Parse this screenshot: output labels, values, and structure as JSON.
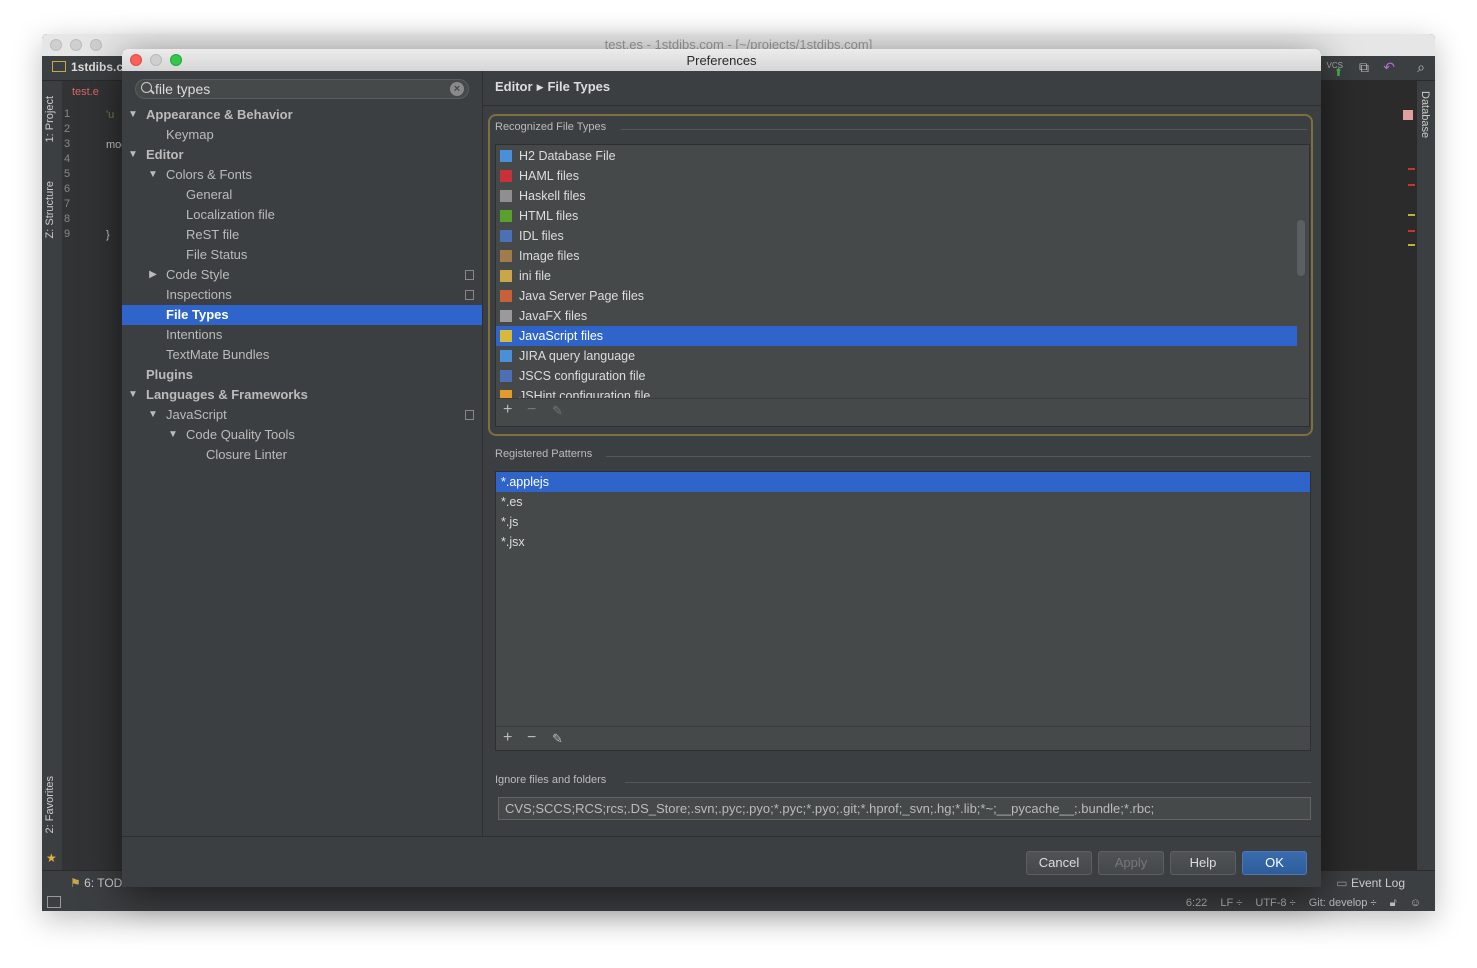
{
  "ide": {
    "window_title": "test.es - 1stdibs.com - [~/projects/1stdibs.com]",
    "project_label": "1stdibs.c",
    "editor_tab": "test.e",
    "left_tabs": [
      "1: Project",
      "Z: Structure",
      "2: Favorites"
    ],
    "right_tab": "Database",
    "vcs_label": "VCS",
    "line_numbers": [
      "1",
      "2",
      "3",
      "4",
      "5",
      "6",
      "7",
      "8",
      "9"
    ],
    "code_fragments": [
      "'u",
      "mod",
      "}"
    ],
    "todo_label": "6: TOD",
    "event_log": "Event Log",
    "status": {
      "position": "6:22",
      "line_sep": "LF",
      "encoding": "UTF-8",
      "vcs_branch": "Git: develop"
    }
  },
  "dialog": {
    "title": "Preferences",
    "search": {
      "value": "file types"
    },
    "tree": [
      {
        "label": "Appearance & Behavior",
        "level": 0,
        "arrow": "▼",
        "bold": true
      },
      {
        "label": "Keymap",
        "level": 1
      },
      {
        "label": "Editor",
        "level": 0,
        "arrow": "▼",
        "bold": true
      },
      {
        "label": "Colors & Fonts",
        "level": 1,
        "arrow": "▼"
      },
      {
        "label": "General",
        "level": 2
      },
      {
        "label": "Localization file",
        "level": 2
      },
      {
        "label": "ReST file",
        "level": 2
      },
      {
        "label": "File Status",
        "level": 2
      },
      {
        "label": "Code Style",
        "level": 1,
        "arrow": "▶",
        "copy": true
      },
      {
        "label": "Inspections",
        "level": 1,
        "copy": true
      },
      {
        "label": "File Types",
        "level": 1,
        "selected": true
      },
      {
        "label": "Intentions",
        "level": 1
      },
      {
        "label": "TextMate Bundles",
        "level": 1
      },
      {
        "label": "Plugins",
        "level": 0,
        "bold": true
      },
      {
        "label": "Languages & Frameworks",
        "level": 0,
        "arrow": "▼",
        "bold": true
      },
      {
        "label": "JavaScript",
        "level": 1,
        "arrow": "▼",
        "copy": true
      },
      {
        "label": "Code Quality Tools",
        "level": 2,
        "arrow": "▼"
      },
      {
        "label": "Closure Linter",
        "level": 3
      }
    ],
    "breadcrumb": {
      "parent": "Editor",
      "current": "File Types"
    },
    "recognized": {
      "title": "Recognized File Types",
      "items": [
        {
          "label": "H2 Database File",
          "icon": "database-icon",
          "color": "#4a90d9"
        },
        {
          "label": "HAML files",
          "icon": "haml-icon",
          "color": "#c8313a"
        },
        {
          "label": "Haskell files",
          "icon": "haskell-icon",
          "color": "#8f8f8f"
        },
        {
          "label": "HTML files",
          "icon": "html-icon",
          "color": "#5aa02c"
        },
        {
          "label": "IDL files",
          "icon": "idl-icon",
          "color": "#4d6fb5"
        },
        {
          "label": "Image files",
          "icon": "image-icon",
          "color": "#a07c4a"
        },
        {
          "label": "ini file",
          "icon": "ini-icon",
          "color": "#c9a64a"
        },
        {
          "label": "Java Server Page files",
          "icon": "jsp-icon",
          "color": "#c8613a"
        },
        {
          "label": "JavaFX files",
          "icon": "javafx-icon",
          "color": "#9a9a9a"
        },
        {
          "label": "JavaScript files",
          "icon": "javascript-icon",
          "color": "#d9b83a",
          "selected": true
        },
        {
          "label": "JIRA query language",
          "icon": "jira-icon",
          "color": "#4a90d9"
        },
        {
          "label": "JSCS configuration file",
          "icon": "json-icon",
          "color": "#4d6fb5"
        },
        {
          "label": "JSHint configuration file",
          "icon": "jshint-icon",
          "color": "#e39b2d"
        }
      ]
    },
    "patterns": {
      "title": "Registered Patterns",
      "items": [
        {
          "label": "*.applejs",
          "selected": true
        },
        {
          "label": "*.es"
        },
        {
          "label": "*.js"
        },
        {
          "label": "*.jsx"
        }
      ]
    },
    "ignore": {
      "title": "Ignore files and folders",
      "value": "CVS;SCCS;RCS;rcs;.DS_Store;.svn;.pyc;.pyo;*.pyc;*.pyo;.git;*.hprof;_svn;.hg;*.lib;*~;__pycache__;.bundle;*.rbc;"
    },
    "toolbar": {
      "add": "+",
      "remove": "−",
      "edit": "✎"
    },
    "buttons": {
      "cancel": "Cancel",
      "apply": "Apply",
      "help": "Help",
      "ok": "OK"
    }
  }
}
